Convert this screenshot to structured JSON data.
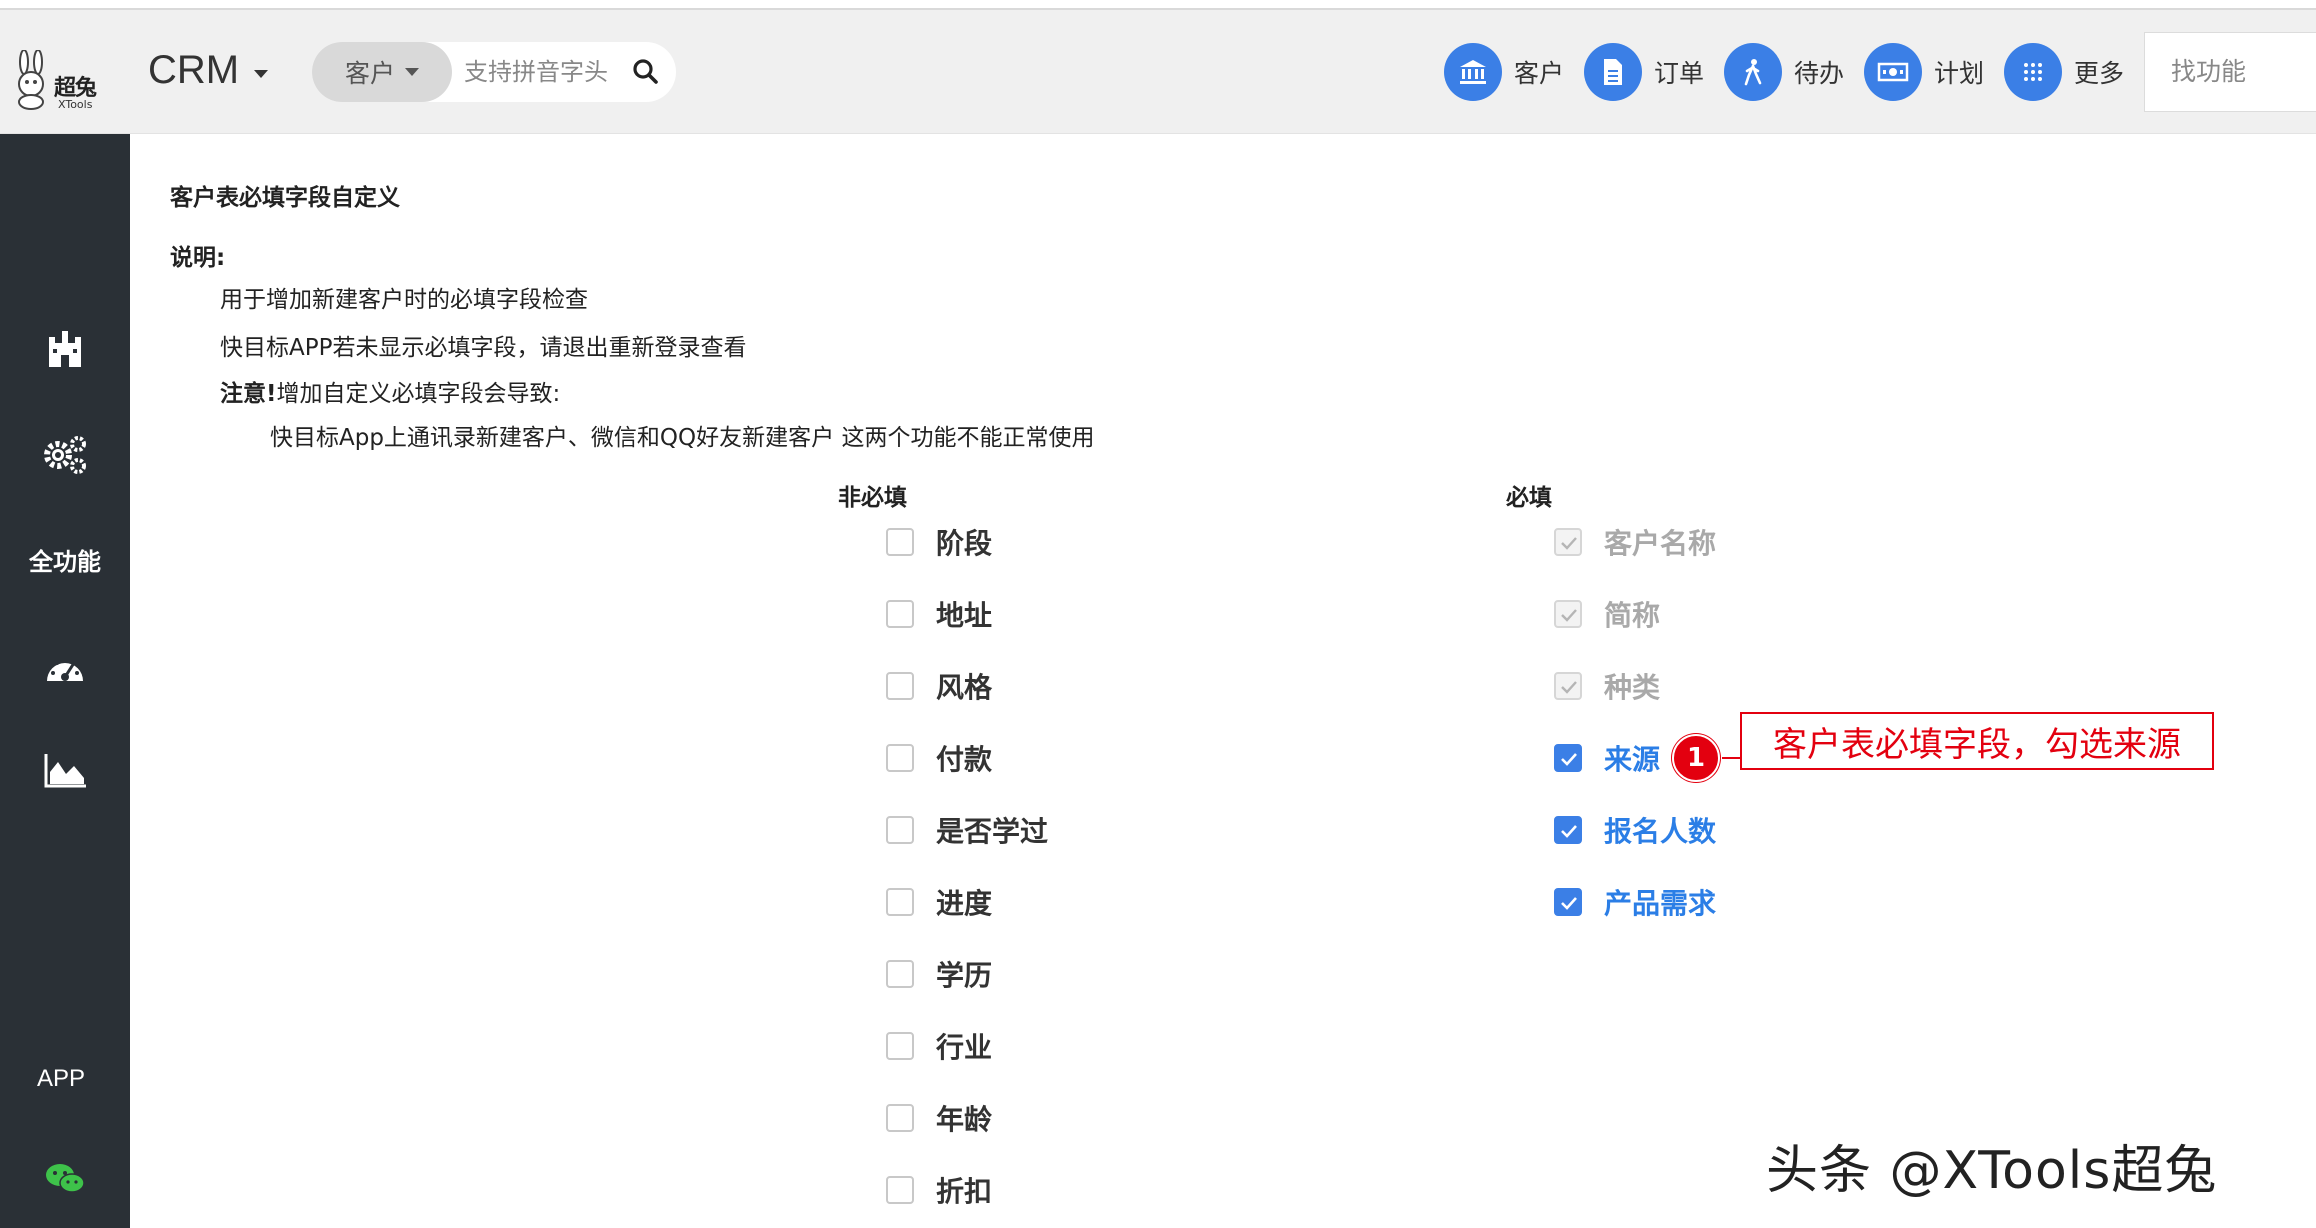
{
  "header": {
    "logo_text": "超兔",
    "logo_sub": "XTools",
    "app_name": "CRM",
    "search": {
      "type_label": "客户",
      "placeholder": "支持拼音字头"
    },
    "quick_nav": [
      {
        "label": "客户",
        "icon": "bank-icon"
      },
      {
        "label": "订单",
        "icon": "document-icon"
      },
      {
        "label": "待办",
        "icon": "walking-person-icon"
      },
      {
        "label": "计划",
        "icon": "money-icon"
      },
      {
        "label": "更多",
        "icon": "grid-icon"
      }
    ],
    "find_placeholder": "找功能"
  },
  "sidebar": {
    "items": [
      {
        "icon": "castle-icon"
      },
      {
        "icon": "gears-icon"
      },
      {
        "label": "全功能"
      },
      {
        "icon": "dashboard-icon"
      },
      {
        "icon": "area-chart-icon"
      },
      {
        "label": "APP"
      },
      {
        "icon": "wechat-icon"
      }
    ]
  },
  "content": {
    "title": "客户表必填字段自定义",
    "desc_heading": "说明:",
    "desc_lines": [
      "用于增加新建客户时的必填字段检查",
      "快目标APP若未显示必填字段，请退出重新登录查看"
    ],
    "warning_title": "注意!",
    "warning_text": "增加自定义必填字段会导致:",
    "warning_detail": "快目标App上通讯录新建客户、微信和QQ好友新建客户 这两个功能不能正常使用",
    "optional_header": "非必填",
    "required_header": "必填",
    "optional_fields": [
      "阶段",
      "地址",
      "风格",
      "付款",
      "是否学过",
      "进度",
      "学历",
      "行业",
      "年龄",
      "折扣"
    ],
    "required_fields_locked": [
      "客户名称",
      "简称",
      "种类"
    ],
    "required_fields_selected": [
      "来源",
      "报名人数",
      "产品需求"
    ]
  },
  "annotation": {
    "number": "1",
    "text": "客户表必填字段，勾选来源"
  },
  "watermark": "头条 @XTools超兔",
  "colors": {
    "accent": "#3b7fe6",
    "sidebar_bg": "#2a3036",
    "annotation_red": "#e3000f"
  }
}
